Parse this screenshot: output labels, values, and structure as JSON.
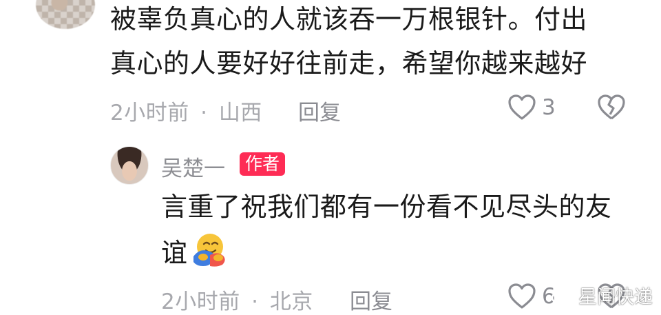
{
  "comment1": {
    "line1": "被辜负真心的人就该吞一万根银针。付出",
    "line2": "真心的人要好好往前走，希望你越来越好",
    "time": "2小时前",
    "location": "山西",
    "dot": "·",
    "reply_label": "回复",
    "like_count": "3"
  },
  "reply1": {
    "author": "吴楚一",
    "badge": "作者",
    "line1": "言重了祝我们都有一份看不见尽头的友",
    "line2": "谊",
    "time": "2小时前",
    "location": "北京",
    "dot": "·",
    "reply_label": "回复",
    "like_count": "6"
  },
  "watermark": {
    "text": "星闻快递",
    "icon": "weibo-icon"
  },
  "icons": {
    "like": "heart-outline-icon",
    "dislike": "broken-heart-icon",
    "emoji": "hugging-face-emoji"
  }
}
